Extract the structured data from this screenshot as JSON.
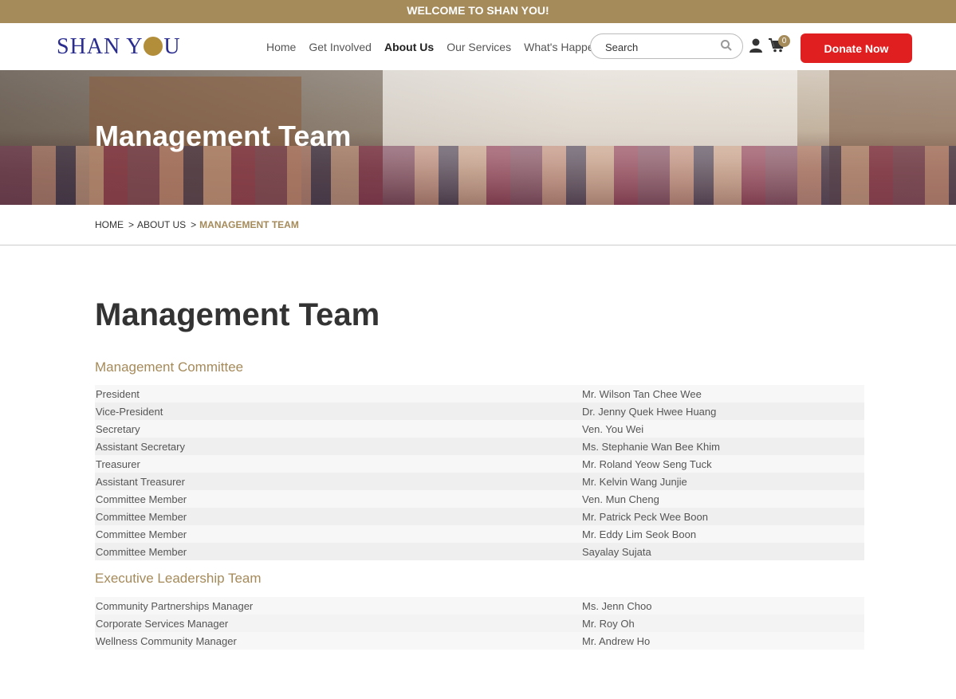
{
  "topbar": {
    "text": "WELCOME TO SHAN YOU!"
  },
  "header": {
    "logo_text_1": "SHAN Y",
    "logo_text_2": "U",
    "nav": [
      {
        "label": "Home"
      },
      {
        "label": "Get Involved"
      },
      {
        "label": "About Us",
        "active": true
      },
      {
        "label": "Our Services"
      },
      {
        "label": "What's Happening"
      }
    ],
    "search_placeholder": "Search",
    "search_icon": "search-icon",
    "user_icon": "user-icon",
    "cart_icon": "cart-icon",
    "cart_count": "0",
    "donate_label": "Donate Now"
  },
  "hero": {
    "title": "Management Team"
  },
  "breadcrumb": {
    "items": [
      "HOME",
      "ABOUT US",
      "MANAGEMENT TEAM"
    ],
    "separator": ">"
  },
  "main": {
    "title": "Management Team",
    "sections": [
      {
        "title": "Management Committee",
        "rows": [
          {
            "role": "President",
            "name": "Mr. Wilson Tan Chee Wee"
          },
          {
            "role": "Vice-President",
            "name": "Dr. Jenny Quek Hwee Huang"
          },
          {
            "role": "Secretary",
            "name": "Ven. You Wei"
          },
          {
            "role": "Assistant Secretary",
            "name": "Ms. Stephanie Wan Bee Khim"
          },
          {
            "role": "Treasurer",
            "name": "Mr. Roland Yeow Seng Tuck"
          },
          {
            "role": "Assistant Treasurer",
            "name": "Mr. Kelvin Wang Junjie"
          },
          {
            "role": "Committee Member",
            "name": "Ven. Mun Cheng"
          },
          {
            "role": "Committee Member",
            "name": "Mr. Patrick Peck Wee Boon"
          },
          {
            "role": "Committee Member",
            "name": "Mr. Eddy Lim Seok Boon"
          },
          {
            "role": "Committee Member",
            "name": "Sayalay Sujata"
          }
        ]
      },
      {
        "title": "Executive Leadership Team",
        "rows": [
          {
            "role": "Community Partnerships Manager",
            "name": "Ms. Jenn Choo"
          },
          {
            "role": "Corporate Services Manager",
            "name": "Mr. Roy Oh"
          },
          {
            "role": "Wellness Community Manager",
            "name": "Mr. Andrew Ho"
          }
        ]
      }
    ]
  },
  "colors": {
    "accent": "#a58a5a",
    "donate": "#e02020",
    "logo": "#2a2d8f"
  }
}
